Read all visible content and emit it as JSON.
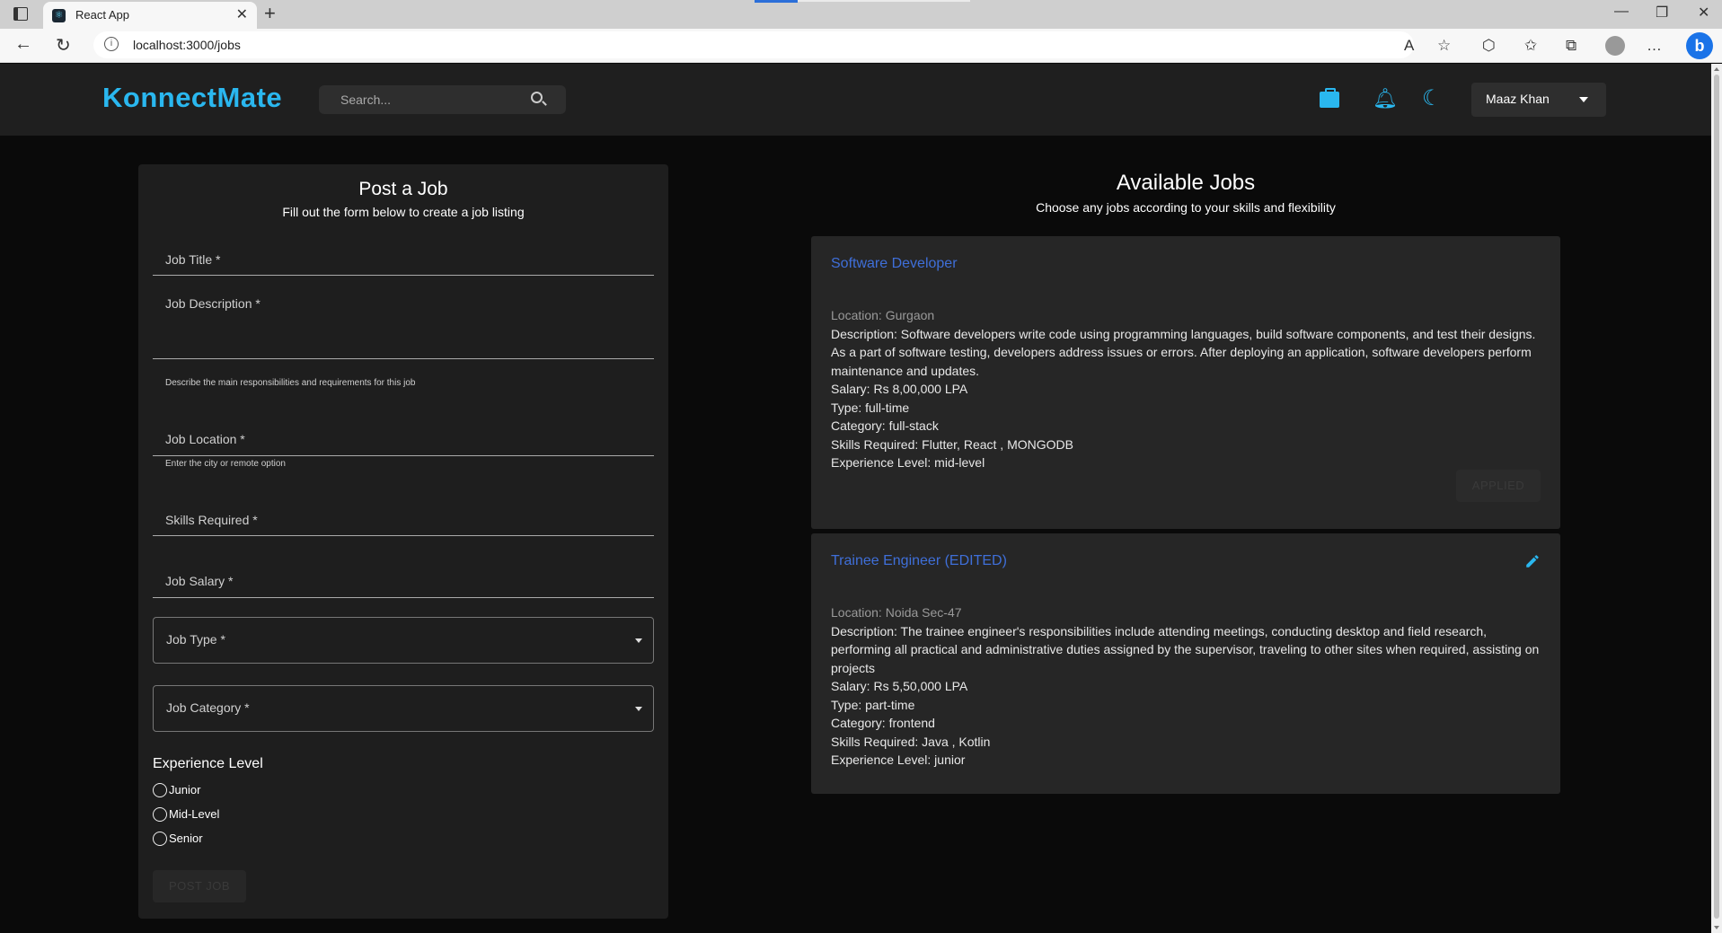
{
  "browser": {
    "tab_title": "React App",
    "url": "localhost:3000/jobs"
  },
  "app": {
    "logo": "KonnectMate",
    "search_placeholder": "Search...",
    "user_name": "Maaz Khan",
    "accent_color": "#2ab7ef",
    "icons": [
      "briefcase-icon",
      "bell-icon",
      "moon-icon"
    ]
  },
  "form": {
    "title": "Post a Job",
    "subtitle": "Fill out the form below to create a job listing",
    "job_title_label": "Job Title *",
    "job_description_label": "Job Description *",
    "job_description_helper": "Describe the main responsibilities and requirements for this job",
    "job_location_label": "Job Location *",
    "job_location_helper": "Enter the city or remote option",
    "skills_label": "Skills Required *",
    "salary_label": "Job Salary *",
    "job_type_label": "Job Type *",
    "job_category_label": "Job Category *",
    "experience_title": "Experience Level",
    "experience_options": [
      "Junior",
      "Mid-Level",
      "Senior"
    ],
    "submit_label": "POST JOB"
  },
  "jobs": {
    "title": "Available Jobs",
    "subtitle": "Choose any jobs according to your skills and flexibility",
    "apply_label": "APPLIED",
    "items": [
      {
        "title": "Software Developer",
        "location": "Location: Gurgaon",
        "description": "Description: Software developers write code using programming languages, build software components, and test their designs. As a part of software testing, developers address issues or errors. After deploying an application, software developers perform maintenance and updates.",
        "salary": "Salary: Rs 8,00,000 LPA",
        "type": "Type: full-time",
        "category": "Category: full-stack",
        "skills": "Skills Required: Flutter, React , MONGODB",
        "experience": "Experience Level: mid-level"
      },
      {
        "title": "Trainee Engineer (EDITED)",
        "location": "Location: Noida Sec-47",
        "description": "Description: The trainee engineer's responsibilities include attending meetings, conducting desktop and field research, performing all practical and administrative duties assigned by the supervisor, traveling to other sites when required, assisting on projects",
        "salary": "Salary: Rs 5,50,000 LPA",
        "type": "Type: part-time",
        "category": "Category: frontend",
        "skills": "Skills Required: Java , Kotlin",
        "experience": "Experience Level: junior"
      }
    ]
  }
}
